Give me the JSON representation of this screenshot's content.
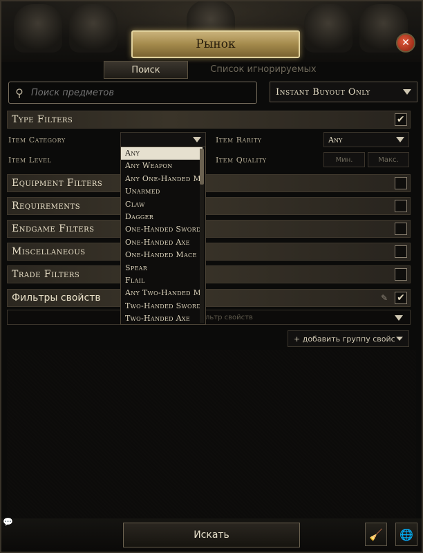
{
  "window": {
    "title": "Рынок"
  },
  "tabs": [
    {
      "label": "Поиск",
      "active": true
    },
    {
      "label": "Список игнорируемых",
      "active": false
    }
  ],
  "search": {
    "placeholder": "Поиск предметов",
    "buyout_value": "Instant Buyout Only"
  },
  "sections": {
    "type_filters": {
      "label": "Type Filters",
      "checked": true
    },
    "equipment_filters": {
      "label": "Equipment Filters",
      "checked": false
    },
    "requirements": {
      "label": "Requirements",
      "checked": false
    },
    "endgame_filters": {
      "label": "Endgame Filters",
      "checked": false
    },
    "miscellaneous": {
      "label": "Miscellaneous",
      "checked": false
    },
    "trade_filters": {
      "label": "Trade Filters",
      "checked": false
    },
    "property_filters": {
      "label": "Фильтры свойств",
      "checked": true
    }
  },
  "type_filter_fields": {
    "item_category_label": "Item Category",
    "item_category_value": "",
    "item_rarity_label": "Item Rarity",
    "item_rarity_value": "Any",
    "item_level_label": "Item Level",
    "item_quality_label": "Item Quality",
    "min_placeholder": "Мин.",
    "max_placeholder": "Макс."
  },
  "category_dropdown": {
    "options": [
      "Any",
      "Any Weapon",
      "Any One-Handed M",
      "Unarmed",
      "Claw",
      "Dagger",
      "One-Handed Sword",
      "One-Handed Axe",
      "One-Handed Mace",
      "Spear",
      "Flail",
      "Any Two-Handed M",
      "Two-Handed Sword",
      "Two-Handed Axe"
    ],
    "selected": "Any"
  },
  "property_filter": {
    "placeholder_visible": "льтр свойств"
  },
  "add_group_label": "+ добавить группу свойс",
  "bottom": {
    "search_button": "Искать"
  },
  "colors": {
    "accent_gold": "#c9b27a",
    "close_red": "#c2391b",
    "background": "#0b0b0a"
  }
}
